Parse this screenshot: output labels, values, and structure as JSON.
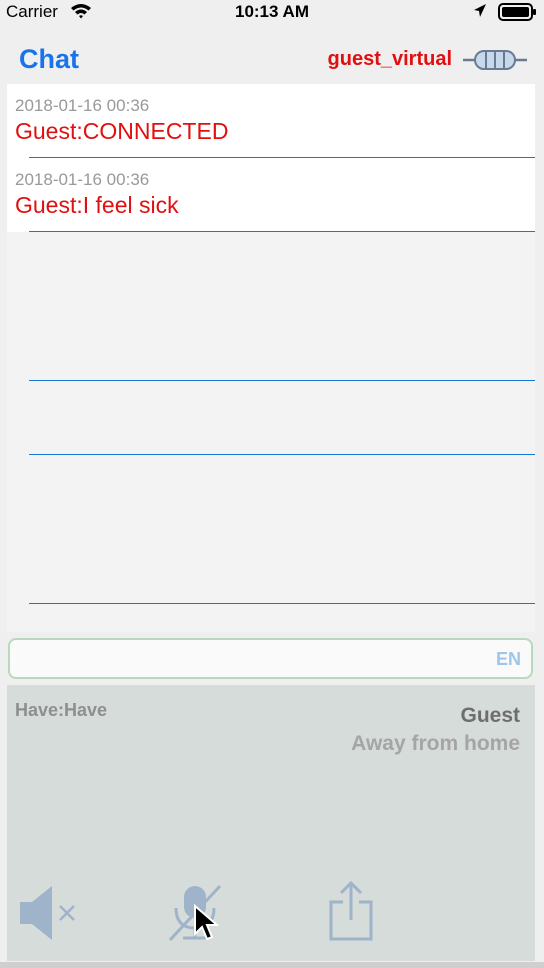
{
  "status": {
    "carrier": "Carrier",
    "time": "10:13 AM"
  },
  "nav": {
    "title": "Chat",
    "username": "guest_virtual"
  },
  "messages": [
    {
      "timestamp": "2018-01-16 00:36",
      "text": "Guest:CONNECTED"
    },
    {
      "timestamp": "2018-01-16 00:36",
      "text": "Guest:I feel sick"
    }
  ],
  "input": {
    "value": "",
    "lang": "EN"
  },
  "panel": {
    "have": "Have:Have",
    "name": "Guest",
    "status": "Away from home"
  },
  "icons": {
    "connection": "plug-icon",
    "speaker": "speaker-muted-icon",
    "mic": "microphone-off-icon",
    "share": "share-icon"
  },
  "colors": {
    "accent": "#1a73e8",
    "user": "#e01010",
    "panel": "#d6dcd9"
  }
}
